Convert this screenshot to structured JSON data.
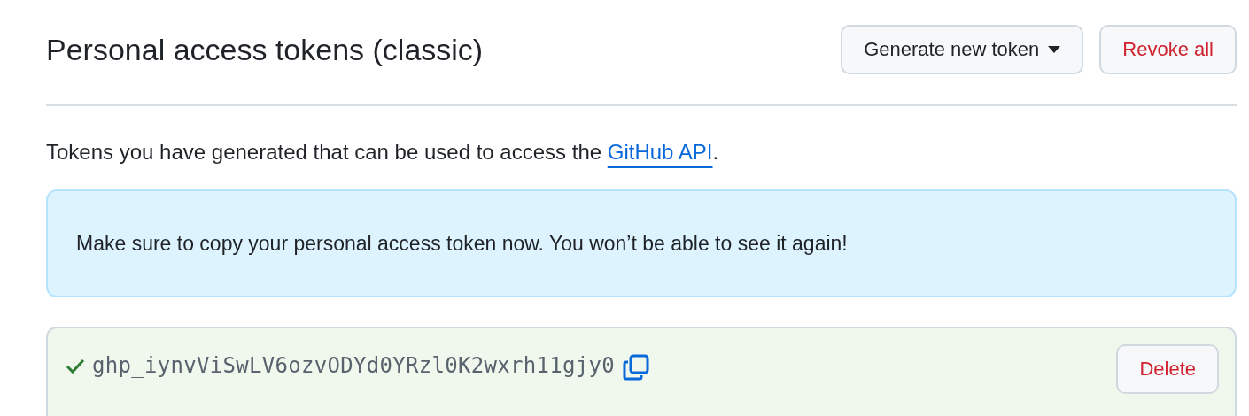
{
  "header": {
    "title": "Personal access tokens (classic)",
    "buttons": [
      {
        "kind": "dropdown",
        "label": "Generate new token"
      },
      {
        "kind": "danger",
        "label": "Revoke all"
      }
    ]
  },
  "intro": {
    "text": "Tokens you have generated that can be used to access the ",
    "link": "GitHub API",
    "after": "."
  },
  "flash": {
    "text": "Make sure to copy your personal access token now. You won’t be able to see it again!"
  },
  "tokens": [
    {
      "value": "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",
      "new": true,
      "delete_label": "Delete"
    }
  ]
}
